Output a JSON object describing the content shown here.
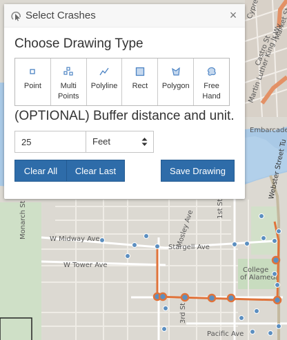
{
  "dialog": {
    "title": "Select Crashes",
    "close_glyph": "×",
    "drawing_heading": "Choose Drawing Type",
    "tools": [
      {
        "id": "point",
        "label_line1": "Point",
        "label_line2": "",
        "icon": "point-icon"
      },
      {
        "id": "multipoint",
        "label_line1": "Multi",
        "label_line2": "Points",
        "icon": "multipoint-icon"
      },
      {
        "id": "polyline",
        "label_line1": "Polyline",
        "label_line2": "",
        "icon": "polyline-icon"
      },
      {
        "id": "rect",
        "label_line1": "Rect",
        "label_line2": "",
        "icon": "rectangle-icon"
      },
      {
        "id": "polygon",
        "label_line1": "Polygon",
        "label_line2": "",
        "icon": "polygon-icon"
      },
      {
        "id": "freehand",
        "label_line1": "Free",
        "label_line2": "Hand",
        "icon": "freehand-icon"
      }
    ],
    "buffer_heading": "(OPTIONAL) Buffer distance and unit.",
    "buffer_distance": "25",
    "buffer_unit": "Feet",
    "buttons": {
      "clear_all": "Clear All",
      "clear_last": "Clear Last",
      "save_drawing": "Save Drawing"
    }
  },
  "map": {
    "street_labels": {
      "midway": "W Midway Ave",
      "tower": "W Tower Ave",
      "stargell": "Stargell Ave",
      "pacific": "Pacific Ave",
      "monarch": "Monarch St",
      "mosley": "Mosley Ave",
      "third": "3rd St",
      "webster": "Webster Street Tu",
      "cypress": "Cypress St",
      "castro": "Castro St",
      "mlk": "Martin Luther King Jr Wy",
      "market": "Market St",
      "embarcadero": "Embarcadero W",
      "college": "College",
      "alameda": "of Alameda",
      "first": "1st St"
    }
  },
  "colors": {
    "button_blue": "#2e6ca9",
    "drawn_line": "#e0733a",
    "crash_point": "#5c8fc0",
    "water": "#a8c8e6",
    "highway": "#e39166"
  }
}
